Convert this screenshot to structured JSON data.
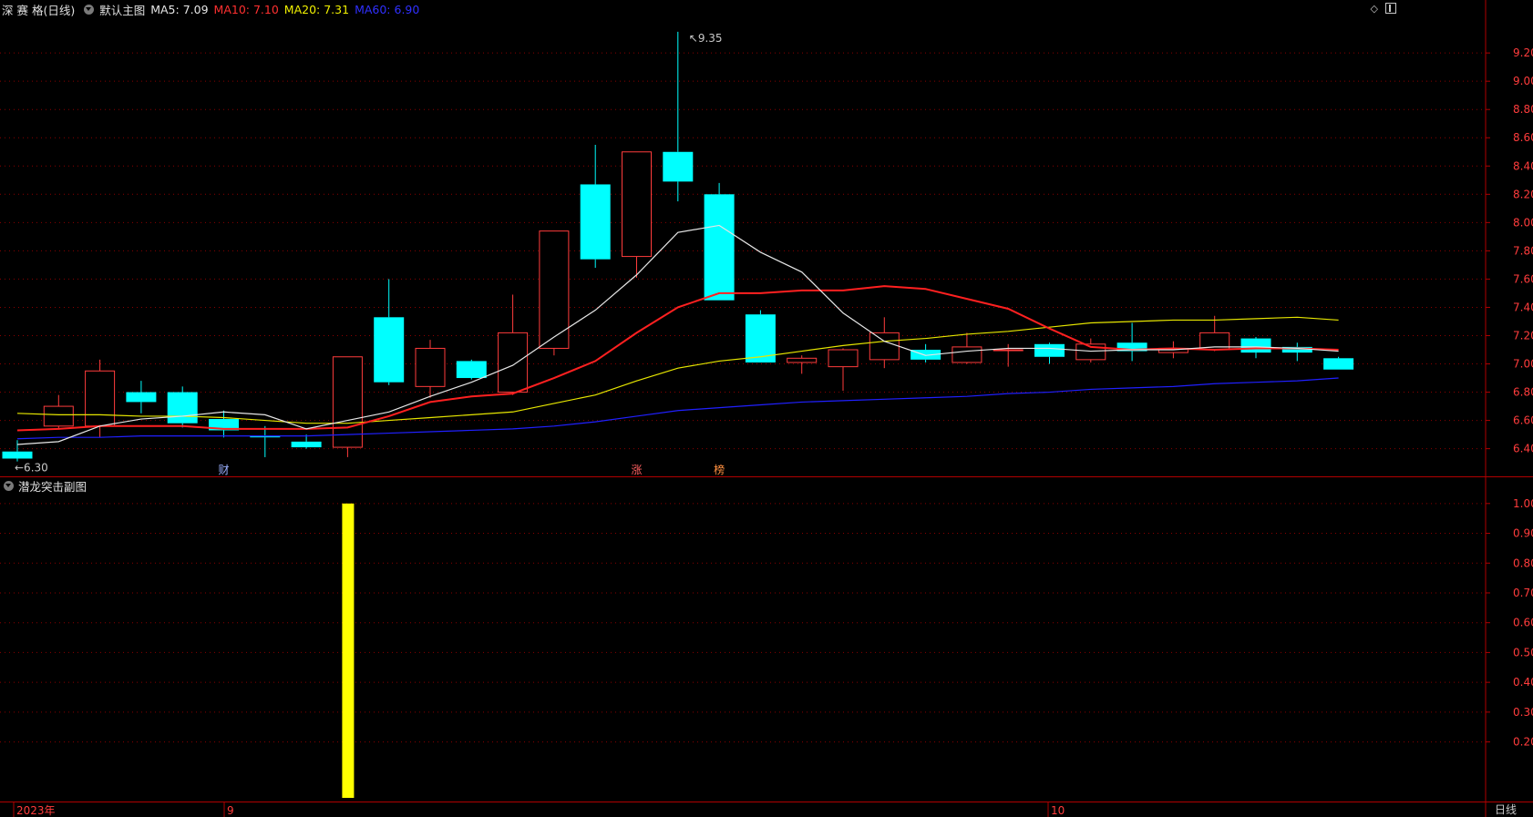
{
  "header": {
    "stock_name": "深 赛 格(日线)",
    "main_chart_label": "默认主图",
    "ma_labels": [
      {
        "text": "MA5: 7.09",
        "color": "#e6e6e6"
      },
      {
        "text": "MA10: 7.10",
        "color": "#ff3030"
      },
      {
        "text": "MA20: 7.31",
        "color": "#f0f000"
      },
      {
        "text": "MA60: 6.90",
        "color": "#3030ff"
      }
    ]
  },
  "subchart": {
    "title": "潜龙突击副图"
  },
  "footer": {
    "year_label": "2023年",
    "month_labels": [
      "9",
      "10"
    ],
    "period_label": "日线"
  },
  "colors": {
    "up": "#ff3c3c",
    "down": "#00ffff",
    "grid": "#8b0000",
    "axis": "#b00000",
    "ma5": "#e6e6e6",
    "ma10": "#ff2020",
    "ma20": "#e6e600",
    "ma60": "#2020ff",
    "signal": "#ffff00"
  },
  "chart_data": [
    {
      "type": "candlestick",
      "y_ticks": [
        "9.20",
        "9.00",
        "8.80",
        "8.60",
        "8.40",
        "8.20",
        "8.00",
        "7.80",
        "7.60",
        "7.40",
        "7.20",
        "7.00",
        "6.80",
        "6.60",
        "6.40"
      ],
      "ylim": [
        6.23,
        9.42
      ],
      "candles": [
        {
          "o": 6.38,
          "h": 6.46,
          "l": 6.31,
          "c": 6.33
        },
        {
          "o": 6.56,
          "h": 6.78,
          "l": 6.54,
          "c": 6.7
        },
        {
          "o": 6.56,
          "h": 7.03,
          "l": 6.48,
          "c": 6.95
        },
        {
          "o": 6.8,
          "h": 6.88,
          "l": 6.65,
          "c": 6.73
        },
        {
          "o": 6.8,
          "h": 6.84,
          "l": 6.55,
          "c": 6.58
        },
        {
          "o": 6.61,
          "h": 6.67,
          "l": 6.48,
          "c": 6.53
        },
        {
          "o": 6.49,
          "h": 6.56,
          "l": 6.34,
          "c": 6.48
        },
        {
          "o": 6.45,
          "h": 6.5,
          "l": 6.4,
          "c": 6.41
        },
        {
          "o": 6.41,
          "h": 7.05,
          "l": 6.34,
          "c": 7.05
        },
        {
          "o": 7.33,
          "h": 7.6,
          "l": 6.85,
          "c": 6.87
        },
        {
          "o": 6.84,
          "h": 7.17,
          "l": 6.76,
          "c": 7.11
        },
        {
          "o": 7.02,
          "h": 7.03,
          "l": 6.89,
          "c": 6.9
        },
        {
          "o": 6.8,
          "h": 7.49,
          "l": 6.78,
          "c": 7.22
        },
        {
          "o": 7.11,
          "h": 7.94,
          "l": 7.06,
          "c": 7.94
        },
        {
          "o": 8.27,
          "h": 8.55,
          "l": 7.68,
          "c": 7.74
        },
        {
          "o": 7.76,
          "h": 8.5,
          "l": 7.61,
          "c": 8.5
        },
        {
          "o": 8.5,
          "h": 9.35,
          "l": 8.15,
          "c": 8.29
        },
        {
          "o": 8.2,
          "h": 8.28,
          "l": 7.45,
          "c": 7.45
        },
        {
          "o": 7.35,
          "h": 7.38,
          "l": 7.01,
          "c": 7.01
        },
        {
          "o": 7.01,
          "h": 7.06,
          "l": 6.93,
          "c": 7.04
        },
        {
          "o": 6.98,
          "h": 7.11,
          "l": 6.81,
          "c": 7.1
        },
        {
          "o": 7.03,
          "h": 7.33,
          "l": 6.97,
          "c": 7.22
        },
        {
          "o": 7.1,
          "h": 7.14,
          "l": 7.01,
          "c": 7.03
        },
        {
          "o": 7.01,
          "h": 7.22,
          "l": 7.0,
          "c": 7.12
        },
        {
          "o": 7.1,
          "h": 7.14,
          "l": 6.98,
          "c": 7.1
        },
        {
          "o": 7.14,
          "h": 7.15,
          "l": 7.0,
          "c": 7.05
        },
        {
          "o": 7.03,
          "h": 7.18,
          "l": 7.01,
          "c": 7.14
        },
        {
          "o": 7.15,
          "h": 7.29,
          "l": 7.02,
          "c": 7.09
        },
        {
          "o": 7.08,
          "h": 7.16,
          "l": 7.04,
          "c": 7.11
        },
        {
          "o": 7.1,
          "h": 7.34,
          "l": 7.09,
          "c": 7.22
        },
        {
          "o": 7.18,
          "h": 7.19,
          "l": 7.04,
          "c": 7.08
        },
        {
          "o": 7.12,
          "h": 7.15,
          "l": 7.02,
          "c": 7.08
        },
        {
          "o": 7.04,
          "h": 7.05,
          "l": 6.96,
          "c": 6.96
        }
      ],
      "ma5": [
        6.43,
        6.45,
        6.56,
        6.61,
        6.63,
        6.66,
        6.64,
        6.54,
        6.6,
        6.66,
        6.77,
        6.87,
        6.99,
        7.19,
        7.38,
        7.63,
        7.93,
        7.98,
        7.79,
        7.65,
        7.36,
        7.16,
        7.06,
        7.09,
        7.11,
        7.11,
        7.09,
        7.1,
        7.1,
        7.12,
        7.12,
        7.11,
        7.09
      ],
      "ma10": [
        6.53,
        6.54,
        6.56,
        6.56,
        6.56,
        6.54,
        6.54,
        6.54,
        6.55,
        6.63,
        6.73,
        6.77,
        6.79,
        6.9,
        7.02,
        7.22,
        7.4,
        7.5,
        7.5,
        7.52,
        7.52,
        7.55,
        7.53,
        7.46,
        7.39,
        7.25,
        7.12,
        7.1,
        7.11,
        7.1,
        7.11,
        7.11,
        7.1
      ],
      "ma20": [
        6.65,
        6.64,
        6.64,
        6.63,
        6.63,
        6.62,
        6.6,
        6.58,
        6.58,
        6.6,
        6.62,
        6.64,
        6.66,
        6.72,
        6.78,
        6.88,
        6.97,
        7.02,
        7.05,
        7.09,
        7.13,
        7.16,
        7.18,
        7.21,
        7.23,
        7.26,
        7.29,
        7.3,
        7.31,
        7.31,
        7.32,
        7.33,
        7.31
      ],
      "ma60": [
        6.47,
        6.48,
        6.48,
        6.49,
        6.49,
        6.49,
        6.49,
        6.49,
        6.5,
        6.51,
        6.52,
        6.53,
        6.54,
        6.56,
        6.59,
        6.63,
        6.67,
        6.69,
        6.71,
        6.73,
        6.74,
        6.75,
        6.76,
        6.77,
        6.79,
        6.8,
        6.82,
        6.83,
        6.84,
        6.86,
        6.87,
        6.88,
        6.9
      ],
      "annotations": [
        {
          "text": "9.35",
          "index": 16,
          "price": 9.35,
          "side": "right",
          "color": "#c8c8c8"
        },
        {
          "text": "6.30",
          "index": 0,
          "price": 6.31,
          "side": "left",
          "color": "#c8c8c8"
        }
      ],
      "markers": [
        {
          "text": "财",
          "index": 5,
          "color": "#9bb0ff"
        },
        {
          "text": "涨",
          "index": 15,
          "color": "#ff6060"
        },
        {
          "text": "榜",
          "index": 17,
          "color": "#ff9040"
        }
      ]
    },
    {
      "type": "bar",
      "title": "潜龙突击副图",
      "y_ticks": [
        "1.00",
        "0.90",
        "0.80",
        "0.70",
        "0.60",
        "0.50",
        "0.40",
        "0.30",
        "0.20"
      ],
      "ylim": [
        0,
        1.03
      ],
      "values": [
        0,
        0,
        0,
        0,
        0,
        0,
        0,
        0,
        1,
        0,
        0,
        0,
        0,
        0,
        0,
        0,
        0,
        0,
        0,
        0,
        0,
        0,
        0,
        0,
        0,
        0,
        0,
        0,
        0,
        0,
        0,
        0,
        0
      ]
    }
  ]
}
